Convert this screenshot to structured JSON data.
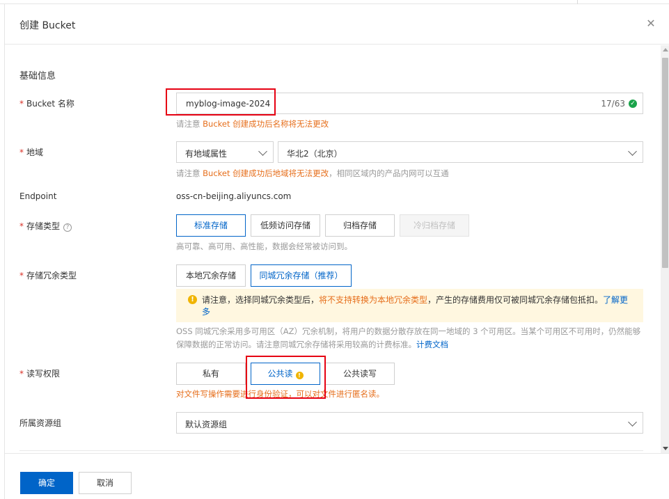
{
  "dialog": {
    "title": "创建 Bucket",
    "close_glyph": "✕"
  },
  "section": {
    "basic_info": "基础信息"
  },
  "bucket_name": {
    "label": "Bucket 名称",
    "value": "myblog-image-2024",
    "count": "17/63",
    "hint_prefix": "请注意 ",
    "hint_warning": "Bucket 创建成功后名称将无法更改"
  },
  "region": {
    "label": "地域",
    "attribute_select": "有地域属性",
    "region_select": "华北2（北京）",
    "hint_prefix": "请注意 ",
    "hint_warning": "Bucket 创建成功后地域将无法更改",
    "hint_suffix": "，相同区域内的产品内网可以互通"
  },
  "endpoint": {
    "label": "Endpoint",
    "value": "oss-cn-beijing.aliyuncs.com"
  },
  "storage_class": {
    "label": "存储类型",
    "options": [
      "标准存储",
      "低频访问存储",
      "归档存储",
      "冷归档存储"
    ],
    "selected": "标准存储",
    "description": "高可靠、高可用、高性能，数据会经常被访问到。"
  },
  "redundancy": {
    "label": "存储冗余类型",
    "options": [
      "本地冗余存储",
      "同城冗余存储（推荐）"
    ],
    "selected": "同城冗余存储（推荐）",
    "notice_prefix": "请注意，选择同城冗余类型后，",
    "notice_warning": "将不支持转换为本地冗余类型",
    "notice_suffix": "，产生的存储费用仅可被同城冗余存储包抵扣。",
    "notice_link": "了解更多",
    "description": "OSS 同城冗余采用多可用区（AZ）冗余机制，将用户的数据分散存放在同一地域的 3 个可用区。当某个可用区不可用时，仍然能够保障数据的正常访问。请注意同城冗余存储将采用较高的计费标准。",
    "description_link": "计费文档"
  },
  "acl": {
    "label": "读写权限",
    "options": [
      "私有",
      "公共读",
      "公共读写"
    ],
    "selected": "公共读",
    "warning": "对文件写操作需要进行身份验证，可以对文件进行匿名读。"
  },
  "resource_group": {
    "label": "所属资源组",
    "value": "默认资源组"
  },
  "footer": {
    "confirm": "确定",
    "cancel": "取消"
  },
  "colors": {
    "primary": "#0064c8",
    "warning_text": "#e66e1b",
    "required_star": "#d93026",
    "annotation_box": "#e60012",
    "notice_bg": "#fff7e0"
  }
}
